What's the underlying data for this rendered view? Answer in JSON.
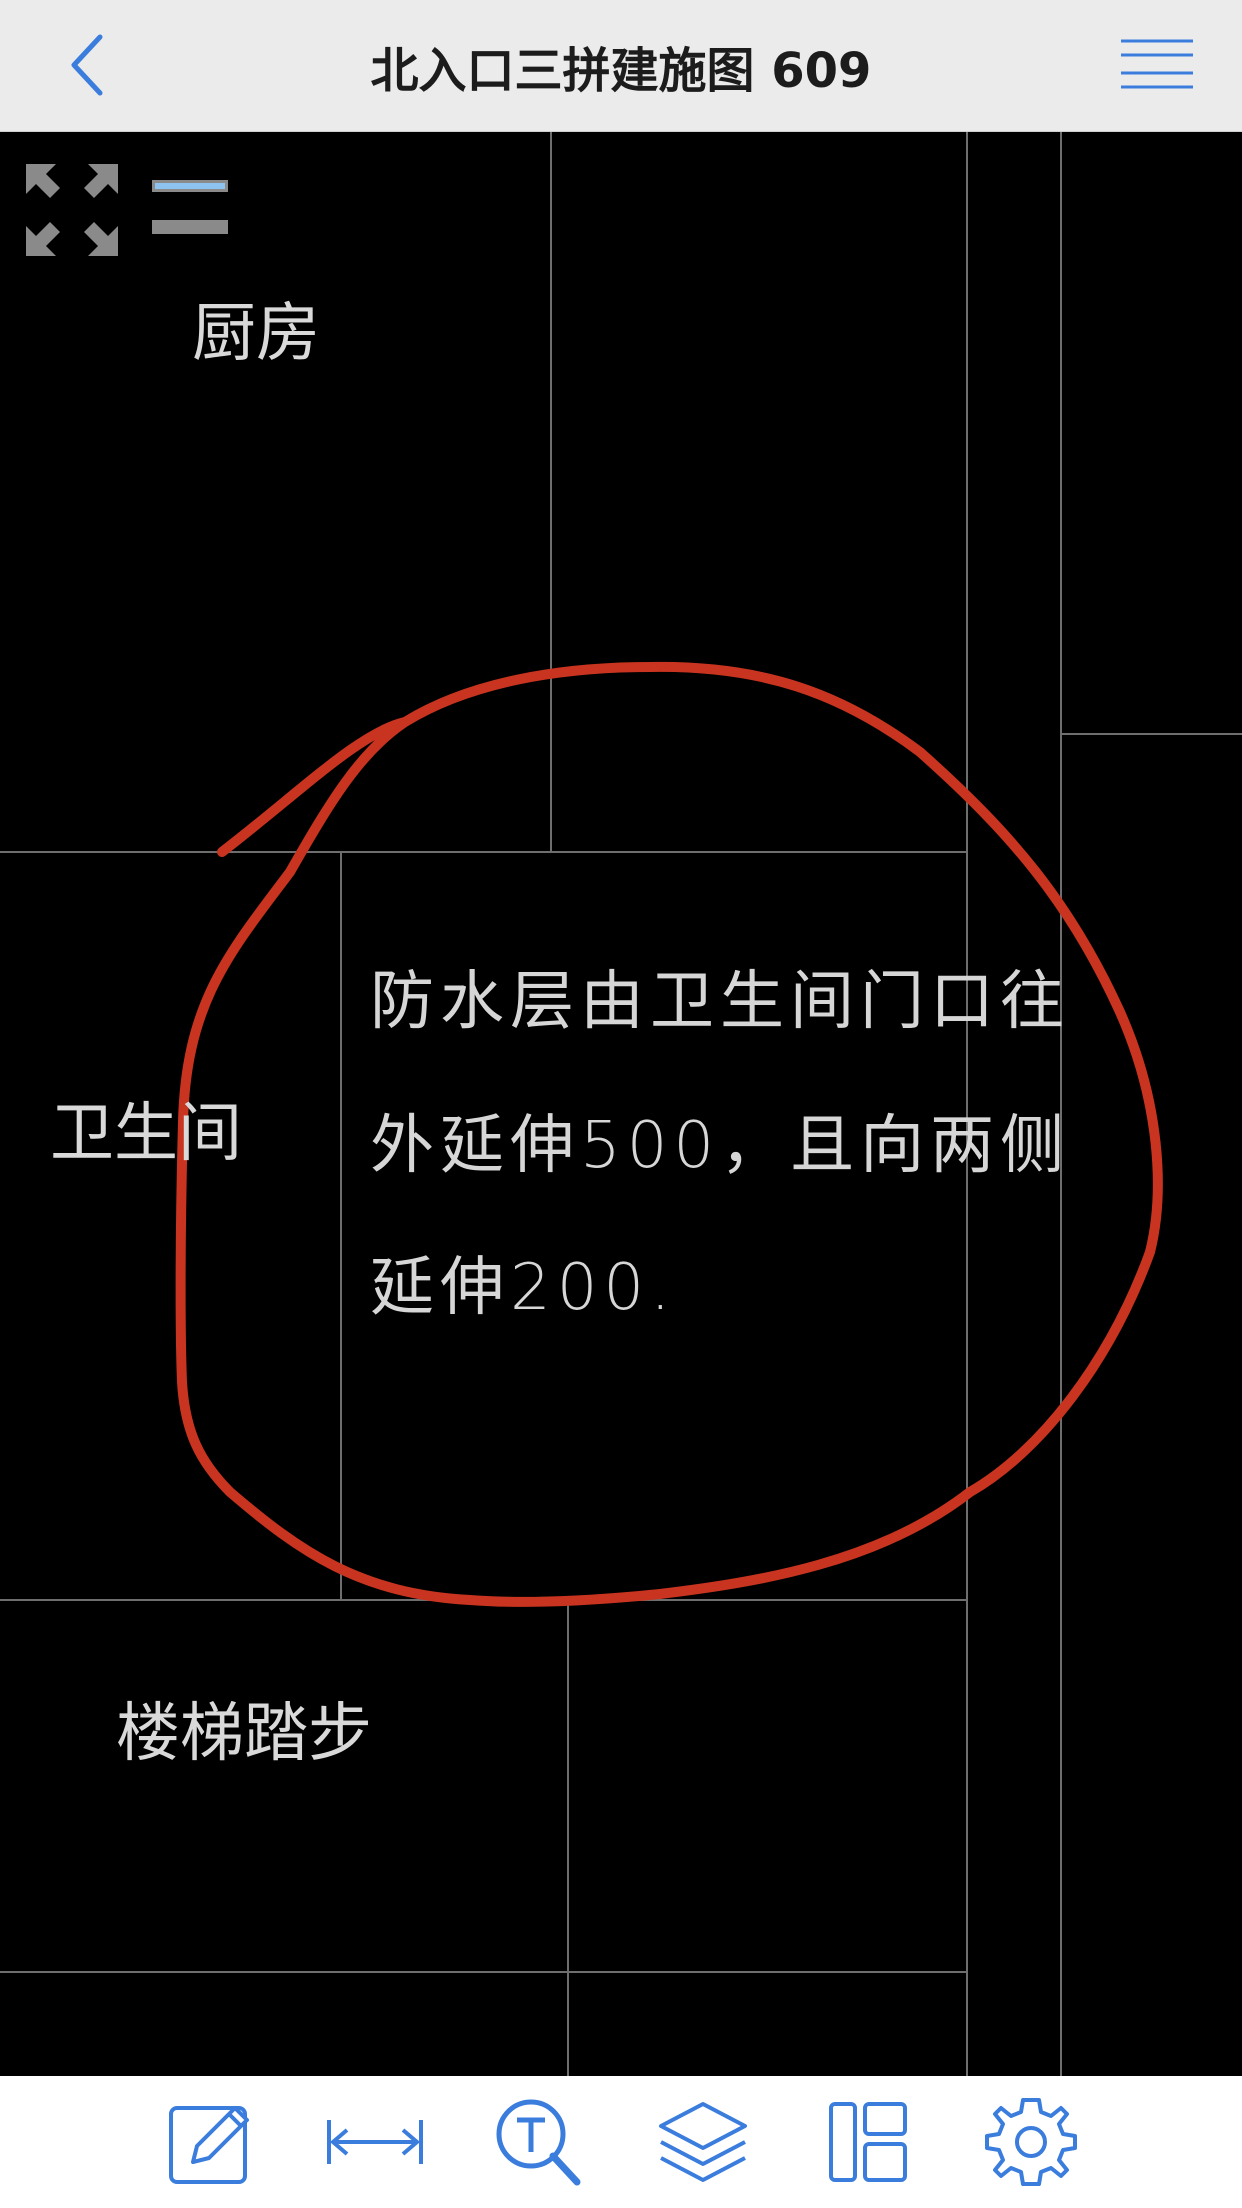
{
  "navbar": {
    "title": "北入口三拼建施图 609",
    "back_icon": "chevron-left-icon",
    "menu_icon": "hamburger-menu-icon"
  },
  "drawing": {
    "labels": {
      "kitchen": "厨房",
      "bathroom": "卫生间",
      "stair_steps": "楼梯踏步"
    },
    "note": {
      "line1": "防水层由卫生间门口往",
      "line2": "外延伸500，且向两侧",
      "line3": "延伸200."
    },
    "markup_color": "#c8341f",
    "line_color": "#6e6e6e",
    "text_color": "#d6d6d6"
  },
  "canvas_controls": {
    "fullscreen_icon": "expand-arrows-icon",
    "layers_icon": "layer-toggle-icon"
  },
  "toolbar": {
    "tools": [
      {
        "name": "edit-markup",
        "icon": "edit-pencil-icon"
      },
      {
        "name": "measure",
        "icon": "measure-distance-icon"
      },
      {
        "name": "text-search",
        "icon": "text-search-icon"
      },
      {
        "name": "layers",
        "icon": "layers-icon"
      },
      {
        "name": "layout",
        "icon": "layout-panel-icon"
      },
      {
        "name": "settings",
        "icon": "gear-icon"
      }
    ],
    "accent_color": "#3b7ddd"
  }
}
